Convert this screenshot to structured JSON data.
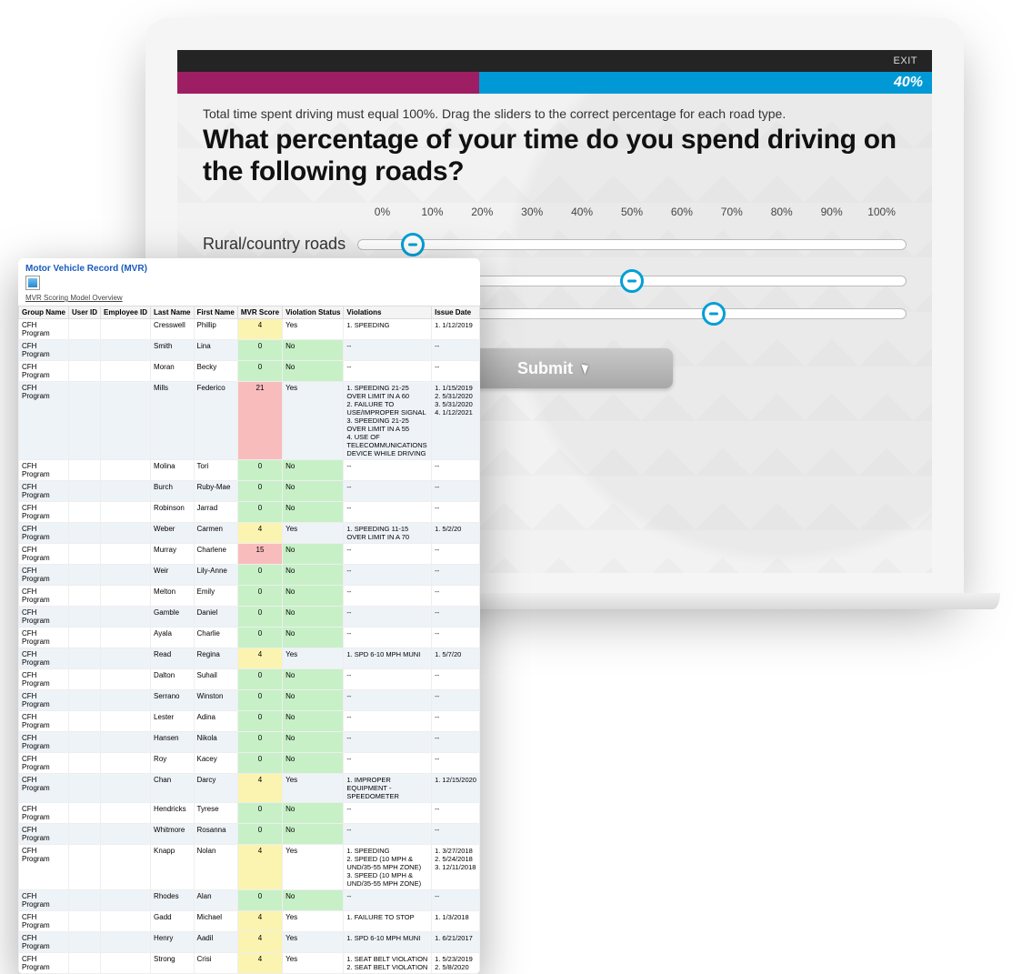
{
  "topbar": {
    "exit": "EXIT"
  },
  "progress": {
    "percent_label": "40%",
    "percent": 40
  },
  "instruction": "Total time spent driving must equal 100%. Drag the sliders to the correct percentage for each road type.",
  "question": "What percentage of your time do you spend driving on the following roads?",
  "ticks": [
    "0%",
    "10%",
    "20%",
    "30%",
    "40%",
    "50%",
    "60%",
    "70%",
    "80%",
    "90%",
    "100%"
  ],
  "sliders": [
    {
      "label": "Rural/country roads",
      "value": 10
    },
    {
      "label": "",
      "value": 50
    },
    {
      "label": "",
      "value": 65
    }
  ],
  "submit_label": "Submit",
  "report": {
    "title": "Motor Vehicle Record (MVR)",
    "subtitle": "MVR Scoring Model Overview",
    "columns": [
      "Group Name",
      "User ID",
      "Employee ID",
      "Last Name",
      "First Name",
      "MVR Score",
      "Violation Status",
      "Violations",
      "Issue Date"
    ],
    "rows": [
      {
        "group": "CFH Program",
        "last": "Cresswell",
        "first": "Phillip",
        "score": 4,
        "score_class": "yellow",
        "status": "Yes",
        "viol": "1. SPEEDING",
        "date": "1. 1/12/2019"
      },
      {
        "group": "CFH Program",
        "last": "Smith",
        "first": "Lina",
        "score": 0,
        "score_class": "green",
        "status": "No",
        "viol": "--",
        "date": "--"
      },
      {
        "group": "CFH Program",
        "last": "Moran",
        "first": "Becky",
        "score": 0,
        "score_class": "green",
        "status": "No",
        "viol": "--",
        "date": "--"
      },
      {
        "group": "CFH Program",
        "last": "Mills",
        "first": "Federico",
        "score": 21,
        "score_class": "red",
        "status": "Yes",
        "viol": "1. SPEEDING 21-25 OVER LIMIT IN A 60\n2. FAILURE TO USE/IMPROPER SIGNAL\n3. SPEEDING 21-25 OVER LIMIT IN A 55\n4. USE OF TELECOMMUNICATIONS DEVICE WHILE DRIVING",
        "date": "1. 1/15/2019\n2. 5/31/2020\n3. 5/31/2020\n4. 1/12/2021"
      },
      {
        "group": "CFH Program",
        "last": "Molina",
        "first": "Tori",
        "score": 0,
        "score_class": "green",
        "status": "No",
        "viol": "--",
        "date": "--"
      },
      {
        "group": "CFH Program",
        "last": "Burch",
        "first": "Ruby-Mae",
        "score": 0,
        "score_class": "green",
        "status": "No",
        "viol": "--",
        "date": "--"
      },
      {
        "group": "CFH Program",
        "last": "Robinson",
        "first": "Jarrad",
        "score": 0,
        "score_class": "green",
        "status": "No",
        "viol": "--",
        "date": "--"
      },
      {
        "group": "CFH Program",
        "last": "Weber",
        "first": "Carmen",
        "score": 4,
        "score_class": "yellow",
        "status": "Yes",
        "viol": "1. SPEEDING 11-15 OVER LIMIT IN A 70",
        "date": "1. 5/2/20"
      },
      {
        "group": "CFH Program",
        "last": "Murray",
        "first": "Charlene",
        "score": 15,
        "score_class": "red",
        "status": "No",
        "viol": "--",
        "date": "--"
      },
      {
        "group": "CFH Program",
        "last": "Weir",
        "first": "Lily-Anne",
        "score": 0,
        "score_class": "green",
        "status": "No",
        "viol": "--",
        "date": "--"
      },
      {
        "group": "CFH Program",
        "last": "Melton",
        "first": "Emily",
        "score": 0,
        "score_class": "green",
        "status": "No",
        "viol": "--",
        "date": "--"
      },
      {
        "group": "CFH Program",
        "last": "Gamble",
        "first": "Daniel",
        "score": 0,
        "score_class": "green",
        "status": "No",
        "viol": "--",
        "date": "--"
      },
      {
        "group": "CFH Program",
        "last": "Ayala",
        "first": "Charlie",
        "score": 0,
        "score_class": "green",
        "status": "No",
        "viol": "--",
        "date": "--"
      },
      {
        "group": "CFH Program",
        "last": "Read",
        "first": "Regina",
        "score": 4,
        "score_class": "yellow",
        "status": "Yes",
        "viol": "1. SPD 6-10 MPH MUNI",
        "date": "1. 5/7/20"
      },
      {
        "group": "CFH Program",
        "last": "Dalton",
        "first": "Suhail",
        "score": 0,
        "score_class": "green",
        "status": "No",
        "viol": "--",
        "date": "--"
      },
      {
        "group": "CFH Program",
        "last": "Serrano",
        "first": "Winston",
        "score": 0,
        "score_class": "green",
        "status": "No",
        "viol": "--",
        "date": "--"
      },
      {
        "group": "CFH Program",
        "last": "Lester",
        "first": "Adina",
        "score": 0,
        "score_class": "green",
        "status": "No",
        "viol": "--",
        "date": "--"
      },
      {
        "group": "CFH Program",
        "last": "Hansen",
        "first": "Nikola",
        "score": 0,
        "score_class": "green",
        "status": "No",
        "viol": "--",
        "date": "--"
      },
      {
        "group": "CFH Program",
        "last": "Roy",
        "first": "Kacey",
        "score": 0,
        "score_class": "green",
        "status": "No",
        "viol": "--",
        "date": "--"
      },
      {
        "group": "CFH Program",
        "last": "Chan",
        "first": "Darcy",
        "score": 4,
        "score_class": "yellow",
        "status": "Yes",
        "viol": "1. IMPROPER EQUIPMENT - SPEEDOMETER",
        "date": "1. 12/15/2020"
      },
      {
        "group": "CFH Program",
        "last": "Hendricks",
        "first": "Tyrese",
        "score": 0,
        "score_class": "green",
        "status": "No",
        "viol": "--",
        "date": "--"
      },
      {
        "group": "CFH Program",
        "last": "Whitmore",
        "first": "Rosanna",
        "score": 0,
        "score_class": "green",
        "status": "No",
        "viol": "--",
        "date": "--"
      },
      {
        "group": "CFH Program",
        "last": "Knapp",
        "first": "Nolan",
        "score": 4,
        "score_class": "yellow",
        "status": "Yes",
        "viol": "1. SPEEDING\n2. SPEED (10 MPH &amp; UND/35-55 MPH ZONE)\n3. SPEED (10 MPH &amp; UND/35-55 MPH ZONE)",
        "date": "1. 3/27/2018\n2. 5/24/2018\n3. 12/11/2018"
      },
      {
        "group": "CFH Program",
        "last": "Rhodes",
        "first": "Alan",
        "score": 0,
        "score_class": "green",
        "status": "No",
        "viol": "--",
        "date": "--"
      },
      {
        "group": "CFH Program",
        "last": "Gadd",
        "first": "Michael",
        "score": 4,
        "score_class": "yellow",
        "status": "Yes",
        "viol": "1. FAILURE TO STOP",
        "date": "1. 1/3/2018"
      },
      {
        "group": "CFH Program",
        "last": "Henry",
        "first": "Aadil",
        "score": 4,
        "score_class": "yellow",
        "status": "Yes",
        "viol": "1. SPD 6-10 MPH MUNI",
        "date": "1. 6/21/2017"
      },
      {
        "group": "CFH Program",
        "last": "Strong",
        "first": "Crisi",
        "score": 4,
        "score_class": "yellow",
        "status": "Yes",
        "viol": "1. SEAT BELT VIOLATION\n2. SEAT BELT VIOLATION",
        "date": "1. 5/23/2019\n2. 5/8/2020"
      }
    ]
  }
}
